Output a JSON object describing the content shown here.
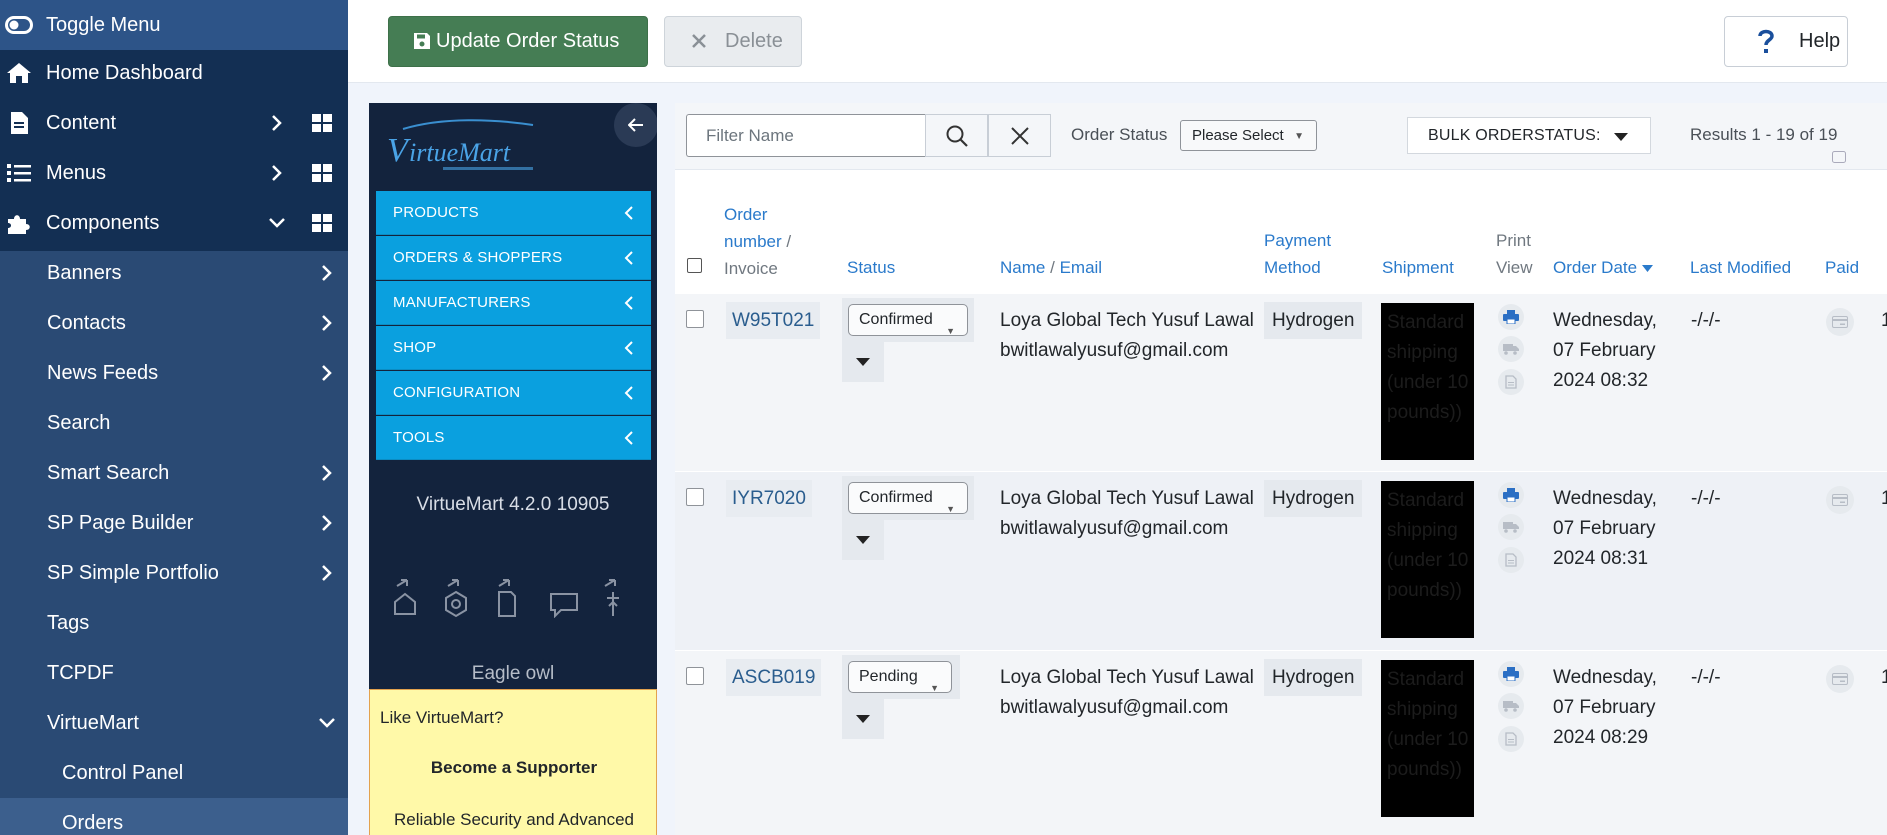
{
  "sidebar": {
    "items": [
      {
        "label": "Toggle Menu",
        "icon": "toggle-icon"
      },
      {
        "label": "Home Dashboard",
        "icon": "home-icon"
      },
      {
        "label": "Content",
        "icon": "file-icon"
      },
      {
        "label": "Menus",
        "icon": "list-icon"
      },
      {
        "label": "Components",
        "icon": "puzzle-icon"
      },
      {
        "label": "Banners"
      },
      {
        "label": "Contacts"
      },
      {
        "label": "News Feeds"
      },
      {
        "label": "Search"
      },
      {
        "label": "Smart Search"
      },
      {
        "label": "SP Page Builder"
      },
      {
        "label": "SP Simple Portfolio"
      },
      {
        "label": "Tags"
      },
      {
        "label": "TCPDF"
      },
      {
        "label": "VirtueMart"
      },
      {
        "label": "Control Panel"
      },
      {
        "label": "Orders"
      }
    ]
  },
  "toolbar": {
    "update_label": "Update Order Status",
    "delete_label": "Delete",
    "help_label": "Help"
  },
  "vm": {
    "nav": [
      "PRODUCTS",
      "ORDERS & SHOPPERS",
      "MANUFACTURERS",
      "SHOP",
      "CONFIGURATION",
      "TOOLS"
    ],
    "version": "VirtueMart 4.2.0 10905",
    "name": "Eagle owl",
    "support": {
      "line1": "Like VirtueMart?",
      "line2": "Become a Supporter",
      "line3": "Reliable Security and Advanced"
    }
  },
  "filters": {
    "placeholder": "Filter Name",
    "order_status_label": "Order Status",
    "order_status_value": "Please Select",
    "bulk_label": "BULK ORDERSTATUS:",
    "results": "Results 1 - 19 of 19"
  },
  "table": {
    "headers": {
      "order_number": "Order",
      "order_number2": "number",
      "order_number_sep": "/",
      "invoice": "Invoice",
      "status": "Status",
      "name": "Name",
      "name_sep": "/",
      "email": "Email",
      "payment1": "Payment",
      "payment2": "Method",
      "shipment": "Shipment",
      "print1": "Print",
      "print2": "View",
      "order_date": "Order Date",
      "last_modified": "Last Modified",
      "paid": "Paid"
    },
    "rows": [
      {
        "order_number": "W95T021",
        "status": "Confirmed",
        "name": "Loya Global Tech Yusuf Lawal",
        "email": "bwitlawalyusuf@gmail.com",
        "payment": "Hydrogen",
        "shipment": "Standard shipping (under 10 pounds))",
        "date_day": "Wednesday,",
        "date": "07 February",
        "time": "2024 08:32",
        "last_modified": "-/-/-",
        "edge": "1"
      },
      {
        "order_number": "IYR7020",
        "status": "Confirmed",
        "name": "Loya Global Tech Yusuf Lawal",
        "email": "bwitlawalyusuf@gmail.com",
        "payment": "Hydrogen",
        "shipment": "Standard shipping (under 10 pounds))",
        "date_day": "Wednesday,",
        "date": "07 February",
        "time": "2024 08:31",
        "last_modified": "-/-/-",
        "edge": "1"
      },
      {
        "order_number": "ASCB019",
        "status": "Pending",
        "name": "Loya Global Tech Yusuf Lawal",
        "email": "bwitlawalyusuf@gmail.com",
        "payment": "Hydrogen",
        "shipment": "Standard shipping (under 10 pounds))",
        "date_day": "Wednesday,",
        "date": "07 February",
        "time": "2024 08:29",
        "last_modified": "-/-/-",
        "edge": "1"
      }
    ]
  },
  "colors": {
    "sidebar_bg": "#132f53",
    "sidebar_sub_bg": "#2a4a74",
    "vm_nav": "#0aa0df",
    "update_btn": "#457d54",
    "link": "#2a7acb"
  }
}
